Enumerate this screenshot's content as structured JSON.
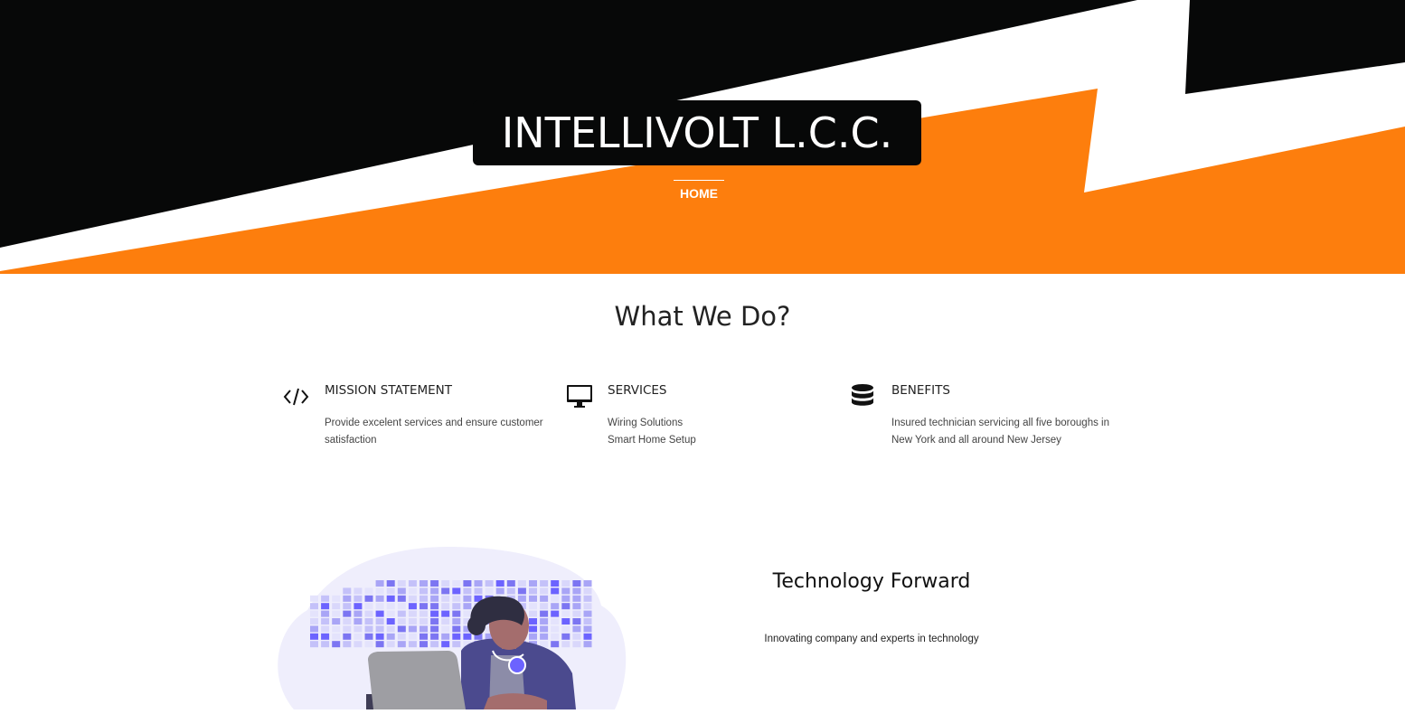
{
  "colors": {
    "orange": "#fd7e0d",
    "black": "#070808",
    "accent_purple": "#6c63ff"
  },
  "header": {
    "brand": "INTELLIVOLT L.C.C.",
    "nav": [
      "HOME"
    ]
  },
  "what_we_do": {
    "title": "What We Do?",
    "features": [
      {
        "icon": "code-icon",
        "title": "MISSION STATEMENT",
        "lines": [
          "Provide excelent services and ensure customer",
          "satisfaction"
        ]
      },
      {
        "icon": "monitor-icon",
        "title": "SERVICES",
        "lines": [
          "Wiring Solutions",
          "Smart Home Setup"
        ]
      },
      {
        "icon": "database-icon",
        "title": "BENEFITS",
        "lines": [
          "Insured technician servicing all five boroughs in",
          "New York and all around New Jersey"
        ]
      }
    ]
  },
  "technology": {
    "title": "Technology Forward",
    "text": "Innovating company and experts in technology"
  }
}
